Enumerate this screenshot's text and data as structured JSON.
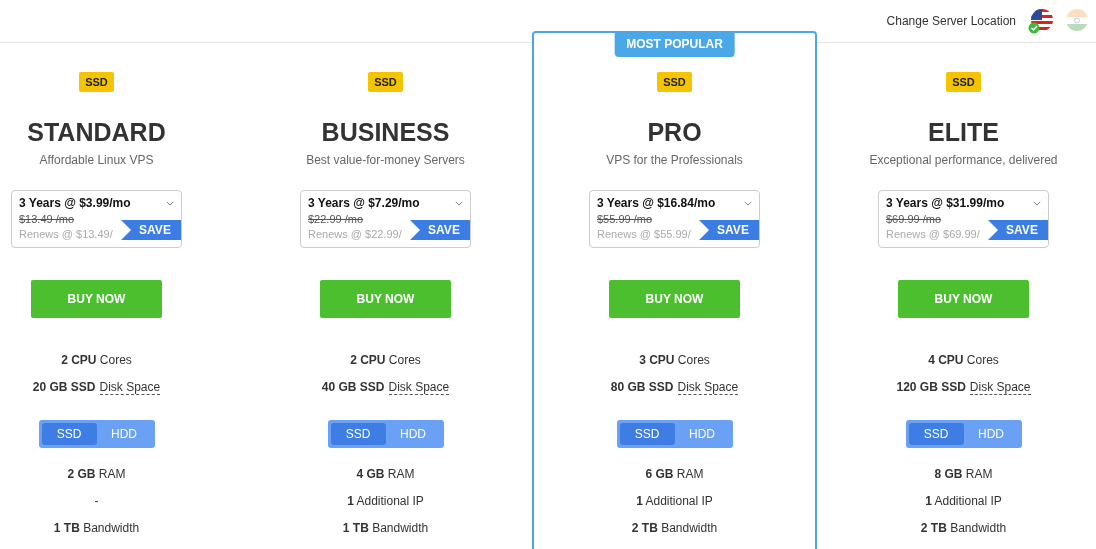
{
  "header": {
    "location_label": "Change Server Location",
    "flags": [
      {
        "selected": true
      },
      {
        "selected": false
      }
    ]
  },
  "plans": [
    {
      "name": "STANDARD",
      "tagline": "Affordable Linux VPS",
      "badge": "SSD",
      "popular": false,
      "term": "3 Years @ $3.99/mo",
      "old_price": "$13.49 /mo",
      "renews": "Renews @ $13.49/",
      "save": "SAVE",
      "button": "BUY NOW",
      "specs": [
        "**2 CPU** Cores",
        "**20 GB SSD**"
      ],
      "spec_link": "Disk Space",
      "storage_options": [
        {
          "label": "SSD",
          "selected": true
        },
        {
          "label": "HDD",
          "selected": false
        }
      ],
      "features": [
        "**2 GB** RAM",
        "-",
        "**1 TB** Bandwidth"
      ]
    },
    {
      "name": "BUSINESS",
      "tagline": "Best value-for-money Servers",
      "badge": "SSD",
      "popular": false,
      "term": "3 Years @ $7.29/mo",
      "old_price": "$22.99 /mo",
      "renews": "Renews @ $22.99/",
      "save": "SAVE",
      "button": "BUY NOW",
      "specs": [
        "**2 CPU** Cores",
        "**40 GB SSD**"
      ],
      "spec_link": "Disk Space",
      "storage_options": [
        {
          "label": "SSD",
          "selected": true
        },
        {
          "label": "HDD",
          "selected": false
        }
      ],
      "features": [
        "**4 GB** RAM",
        "**1** Additional IP",
        "**1 TB** Bandwidth"
      ]
    },
    {
      "name": "PRO",
      "tagline": "VPS for the Professionals",
      "badge": "SSD",
      "popular": true,
      "popular_label": "MOST POPULAR",
      "term": "3 Years @ $16.84/mo",
      "old_price": "$55.99 /mo",
      "renews": "Renews @ $55.99/",
      "save": "SAVE",
      "button": "BUY NOW",
      "specs": [
        "**3 CPU** Cores",
        "**80 GB SSD**"
      ],
      "spec_link": "Disk Space",
      "storage_options": [
        {
          "label": "SSD",
          "selected": true
        },
        {
          "label": "HDD",
          "selected": false
        }
      ],
      "features": [
        "**6 GB** RAM",
        "**1** Additional IP",
        "**2 TB** Bandwidth"
      ]
    },
    {
      "name": "ELITE",
      "tagline": "Exceptional performance, delivered",
      "badge": "SSD",
      "popular": false,
      "term": "3 Years @ $31.99/mo",
      "old_price": "$69.99 /mo",
      "renews": "Renews @ $69.99/",
      "save": "SAVE",
      "button": "BUY NOW",
      "specs": [
        "**4 CPU** Cores",
        "**120 GB SSD**"
      ],
      "spec_link": "Disk Space",
      "storage_options": [
        {
          "label": "SSD",
          "selected": true
        },
        {
          "label": "HDD",
          "selected": false
        }
      ],
      "features": [
        "**8 GB** RAM",
        "**1** Additional IP",
        "**2 TB** Bandwidth"
      ]
    }
  ]
}
